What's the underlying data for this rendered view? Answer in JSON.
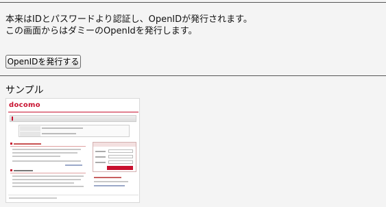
{
  "message": {
    "line1": "本来はIDとパスワードより認証し、OpenIDが発行されます。",
    "line2": "この画面からはダミーのOpenIdを発行します。"
  },
  "issue_button": {
    "label": "OpenIDを発行する"
  },
  "sample": {
    "heading": "サンプル",
    "thumbnail": {
      "logo_text": "docomo",
      "accent_color": "#c8102e"
    }
  }
}
